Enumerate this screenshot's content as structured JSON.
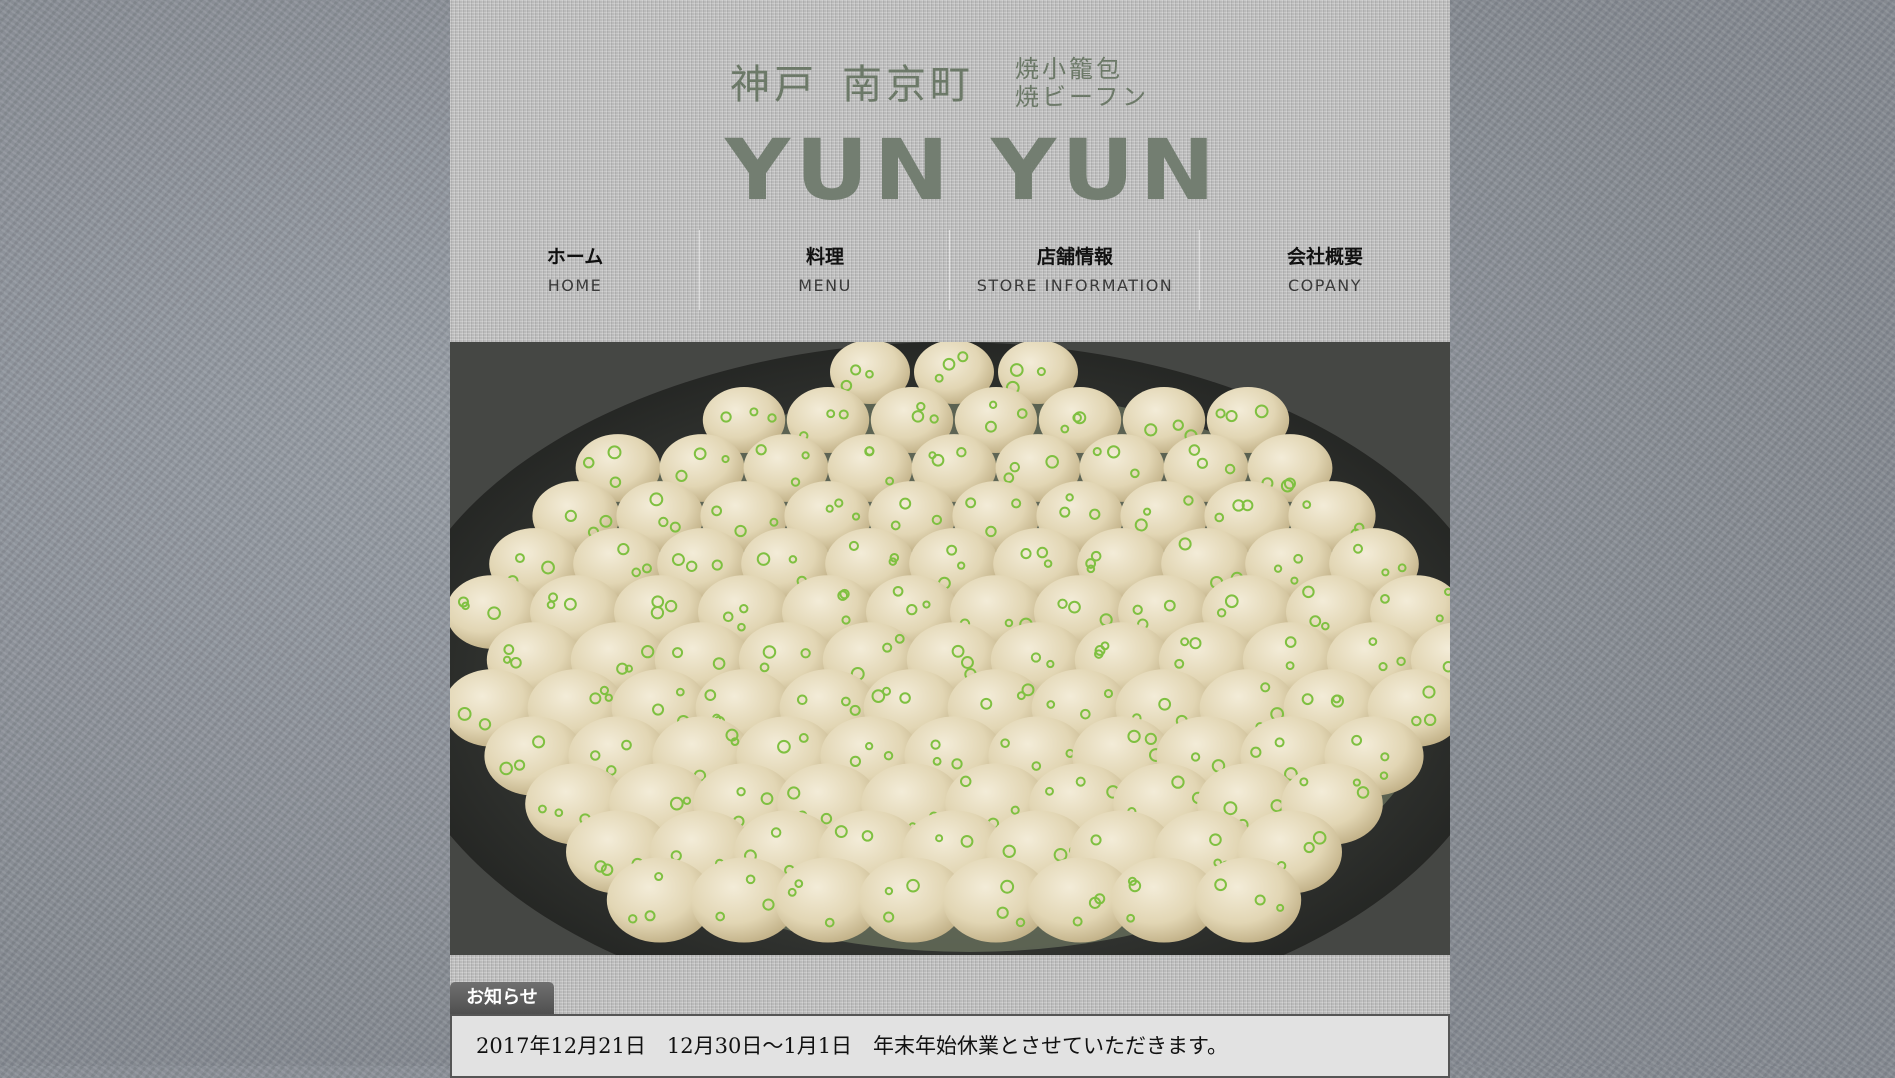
{
  "logo": {
    "kanji_left": "神戸",
    "kanji_right": "南京町",
    "sub_line1": "焼小籠包",
    "sub_line2": "焼ビーフン",
    "brand": "YUN YUN"
  },
  "nav": [
    {
      "jp": "ホーム",
      "en": "HOME"
    },
    {
      "jp": "料理",
      "en": "MENU"
    },
    {
      "jp": "店舗情報",
      "en": "STORE INFORMATION"
    },
    {
      "jp": "会社概要",
      "en": "COPANY"
    }
  ],
  "notice": {
    "tab_label": "お知らせ",
    "text": "2017年12月21日　12月30日～1月1日　年末年始休業とさせていただきます。"
  },
  "colors": {
    "logo_green": "#6c7968",
    "page_bg": "#c4c4c4",
    "notice_tab": "#5f5f5f"
  }
}
